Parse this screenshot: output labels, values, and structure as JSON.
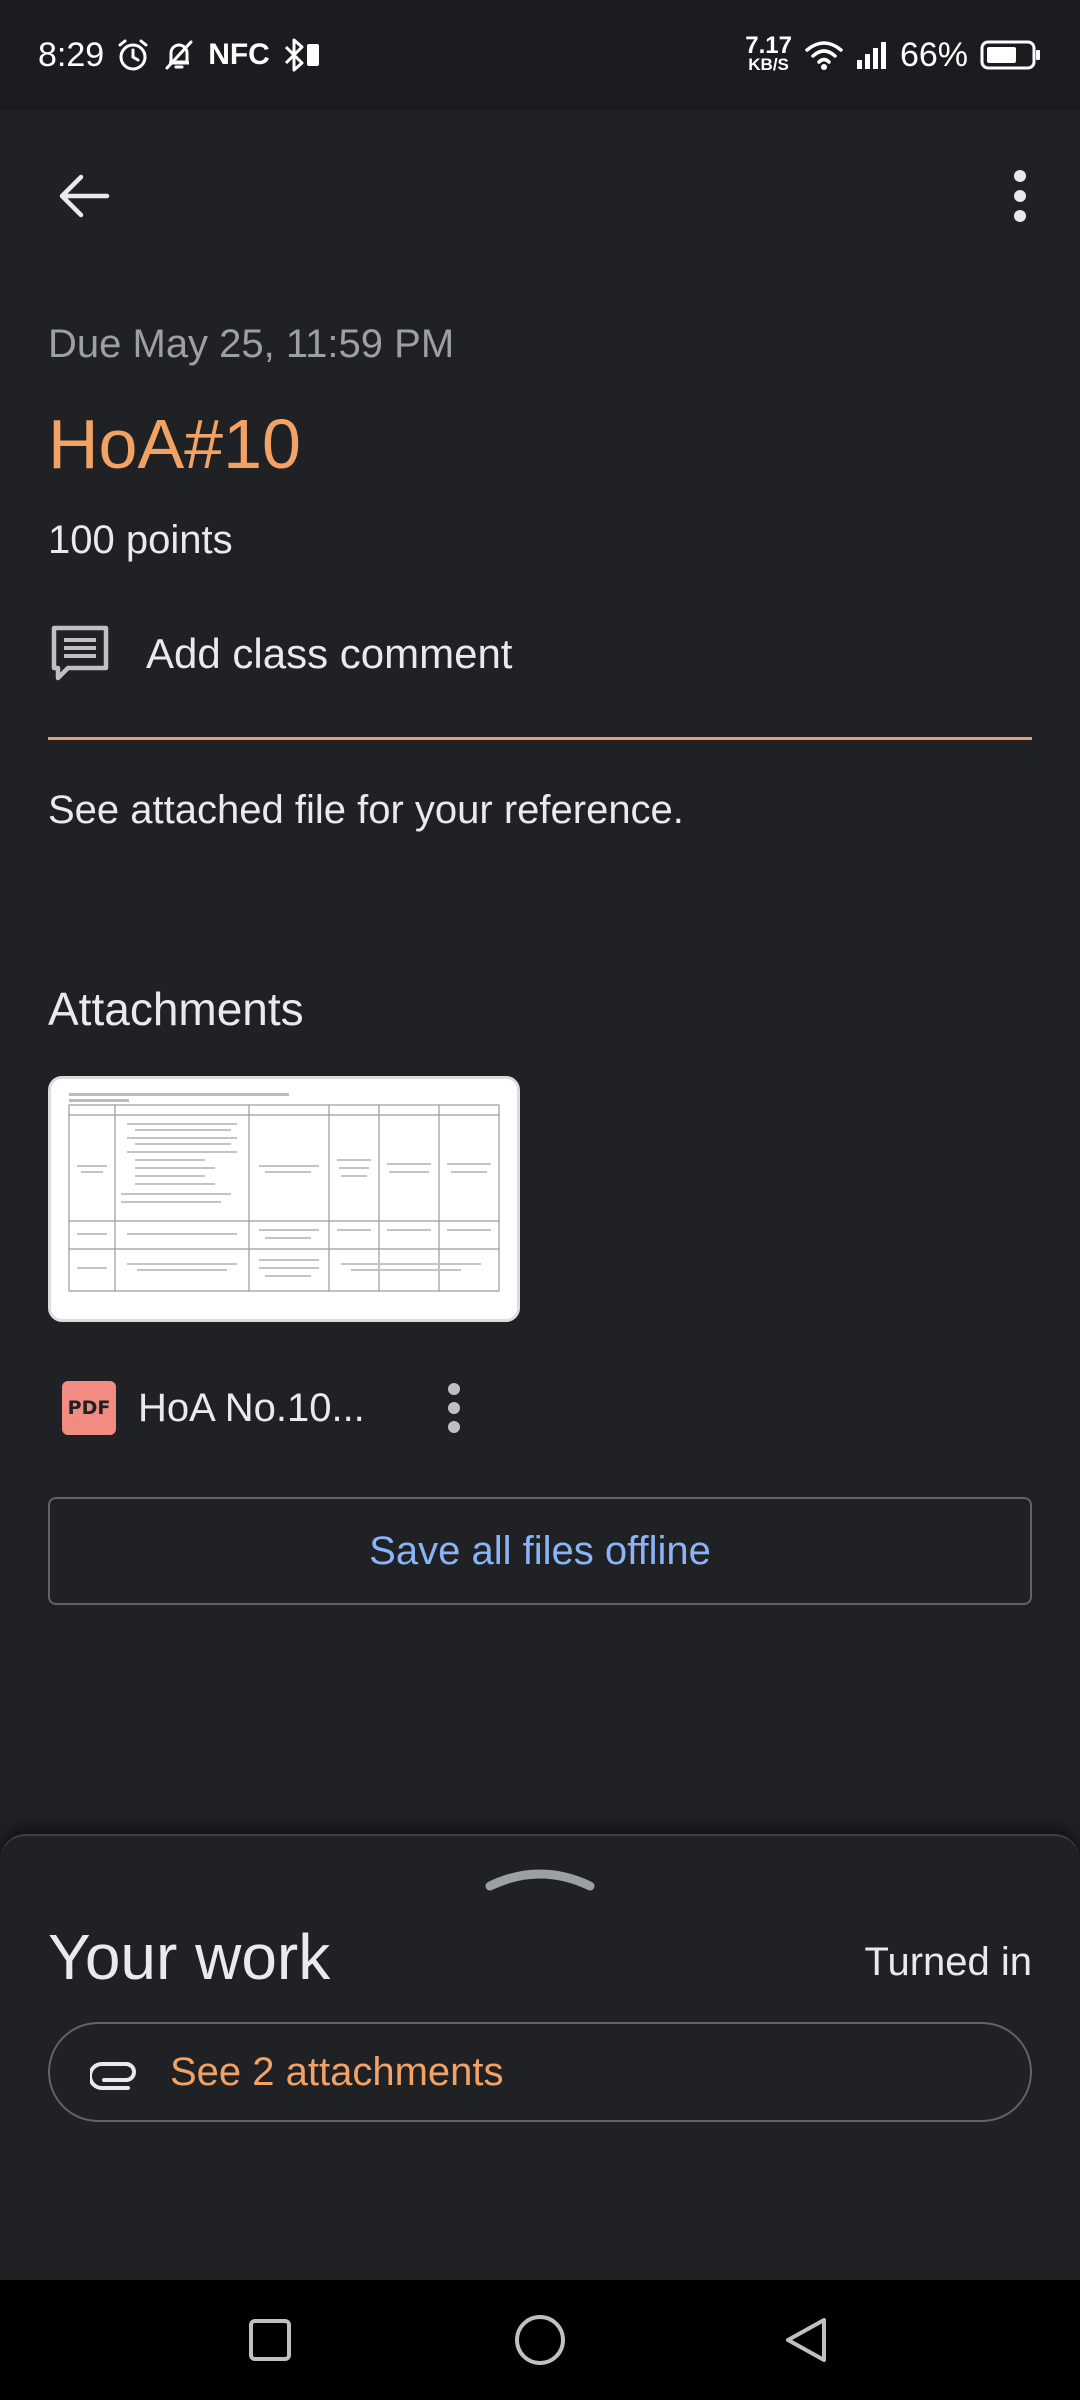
{
  "status_bar": {
    "time": "8:29",
    "nfc": "NFC",
    "net_speed_value": "7.17",
    "net_speed_unit": "KB/S",
    "battery": "66%"
  },
  "app_bar": {
    "back_icon": "arrow-back-icon",
    "more_icon": "more-vert-icon"
  },
  "assignment": {
    "due": "Due May 25, 11:59 PM",
    "title": "HoA#10",
    "points": "100 points",
    "add_comment_label": "Add class comment",
    "description": "See attached file for your reference."
  },
  "attachments": {
    "heading": "Attachments",
    "items": [
      {
        "type_badge": "PDF",
        "name": "HoA No.10..."
      }
    ],
    "save_offline_label": "Save all files offline"
  },
  "your_work": {
    "heading": "Your work",
    "status": "Turned in",
    "see_attachments_label": "See 2 attachments"
  },
  "colors": {
    "accent": "#f3a265",
    "link": "#8ab4f8",
    "background": "#202124",
    "pdf_badge": "#f28b82"
  }
}
